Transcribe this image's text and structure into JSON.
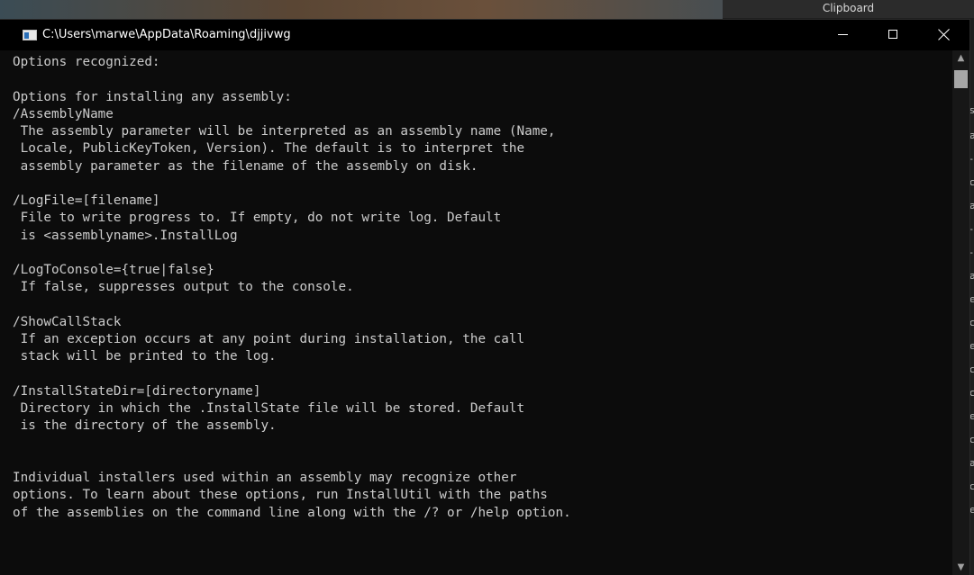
{
  "clipboard": {
    "title": "Clipboard",
    "edge_chars": [
      "s",
      "a",
      "-",
      "c",
      "a",
      "-",
      "-",
      "a",
      "e",
      "c",
      "e",
      "c",
      "c",
      "e",
      "c",
      "a",
      "c",
      "e"
    ]
  },
  "window": {
    "title": "C:\\Users\\marwe\\AppData\\Roaming\\djjivwg",
    "buttons": {
      "minimize": "minimize",
      "maximize": "maximize",
      "close": "close"
    }
  },
  "console": {
    "lines": [
      "Options recognized:",
      "",
      "Options for installing any assembly:",
      "/AssemblyName",
      " The assembly parameter will be interpreted as an assembly name (Name,",
      " Locale, PublicKeyToken, Version). The default is to interpret the",
      " assembly parameter as the filename of the assembly on disk.",
      "",
      "/LogFile=[filename]",
      " File to write progress to. If empty, do not write log. Default",
      " is <assemblyname>.InstallLog",
      "",
      "/LogToConsole={true|false}",
      " If false, suppresses output to the console.",
      "",
      "/ShowCallStack",
      " If an exception occurs at any point during installation, the call",
      " stack will be printed to the log.",
      "",
      "/InstallStateDir=[directoryname]",
      " Directory in which the .InstallState file will be stored. Default",
      " is the directory of the assembly.",
      "",
      "",
      "Individual installers used within an assembly may recognize other",
      "options. To learn about these options, run InstallUtil with the paths",
      "of the assemblies on the command line along with the /? or /help option."
    ]
  },
  "scrollbar": {
    "up_arrow": "▲",
    "down_arrow": "▼"
  }
}
